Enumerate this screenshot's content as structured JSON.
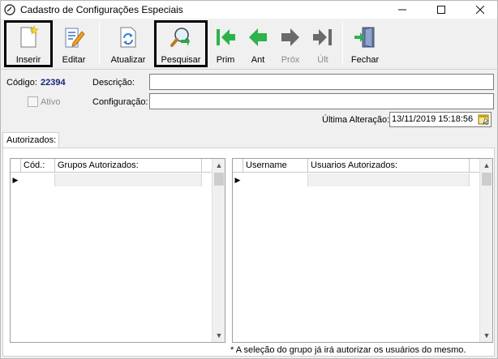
{
  "window": {
    "title": "Cadastro de Configurações Especiais"
  },
  "toolbar": {
    "inserir": "Inserir",
    "editar": "Editar",
    "atualizar": "Atualizar",
    "pesquisar": "Pesquisar",
    "prim": "Prim",
    "ant": "Ant",
    "prox": "Próx",
    "ult": "Últ",
    "fechar": "Fechar"
  },
  "form": {
    "codigo_label": "Código:",
    "codigo_value": "22394",
    "descricao_label": "Descrição:",
    "descricao_value": "",
    "ativo_label": "Ativo",
    "ativo_checked": false,
    "configuracao_label": "Configuração:",
    "configuracao_value": "",
    "ultima_alteracao_label": "Última Alteração:",
    "ultima_alteracao_value": "13/11/2019 15:18:56"
  },
  "tabs": [
    {
      "label": "Autorizados:"
    }
  ],
  "grupos_grid": {
    "columns": [
      "Cód.:",
      "Grupos Autorizados:"
    ],
    "rows": [
      [
        "",
        ""
      ]
    ]
  },
  "usuarios_grid": {
    "columns": [
      "Username",
      "Usuarios Autorizados:"
    ],
    "rows": [
      [
        "",
        ""
      ]
    ]
  },
  "note": "* A seleção do grupo já irá autorizar os usuários do mesmo.",
  "colors": {
    "codigo_value": "#1a237e",
    "nav_green": "#2db34a",
    "nav_grey": "#6a6a6a"
  }
}
